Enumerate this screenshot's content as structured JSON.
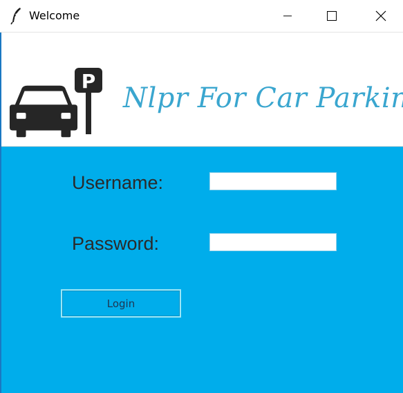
{
  "window": {
    "title": "Welcome",
    "icon": "feather-icon",
    "controls": {
      "minimize": "minimize-icon",
      "maximize": "maximize-icon",
      "close": "close-icon"
    }
  },
  "banner": {
    "brand_text": "Nlpr For Car Parking",
    "logo_icons": [
      "car-icon",
      "parking-sign-icon"
    ],
    "parking_letter": "P",
    "brand_color": "#3aa6cf"
  },
  "form": {
    "username_label": "Username:",
    "username_value": "",
    "password_label": "Password:",
    "password_value": "",
    "login_label": "Login",
    "panel_color": "#00adeb"
  }
}
